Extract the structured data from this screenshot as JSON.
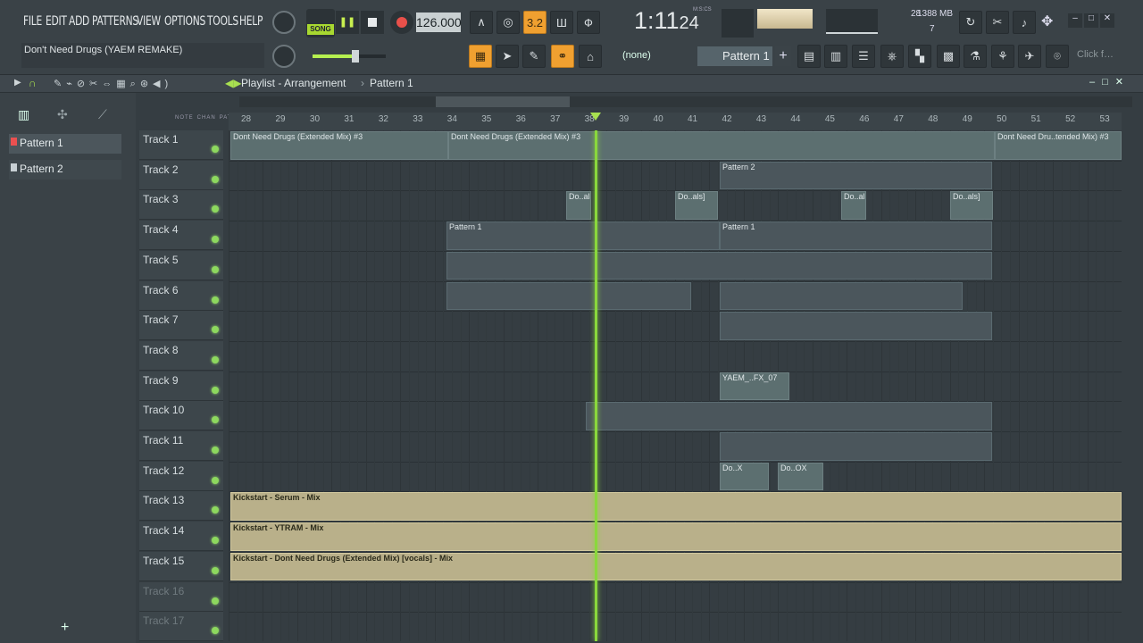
{
  "menu": [
    "FILE",
    "EDIT",
    "ADD",
    "PATTERNS",
    "VIEW",
    "OPTIONS",
    "TOOLS",
    "HELP"
  ],
  "transport": {
    "mode": "SONG",
    "tempo": "126.000",
    "time": "1:11",
    "time_sub": "24",
    "time_unit": "M:S:CS"
  },
  "hint": "Don't Need Drugs (YAEM REMAKE)",
  "cpu": {
    "ram": "1388 MB",
    "poly": "28",
    "num": "7"
  },
  "pattern_select": {
    "none": "(none)",
    "current": "Pattern 1"
  },
  "click_hint": "Click f…",
  "breadcrumb": {
    "title": "Playlist - Arrangement",
    "pattern": "Pattern 1"
  },
  "picker": [
    {
      "label": "Pattern 1",
      "selected": true
    },
    {
      "label": "Pattern 2",
      "selected": false
    }
  ],
  "ruler": [
    "28",
    "29",
    "30",
    "31",
    "32",
    "33",
    "34",
    "35",
    "36",
    "37",
    "38",
    "39",
    "40",
    "41",
    "42",
    "43",
    "44",
    "45",
    "46",
    "47",
    "48",
    "49",
    "50",
    "51",
    "52",
    "53"
  ],
  "ruler_labels": [
    "NOTE",
    "CHAN",
    "PAT"
  ],
  "tracks": [
    {
      "name": "Track 1",
      "dim": false
    },
    {
      "name": "Track 2",
      "dim": false
    },
    {
      "name": "Track 3",
      "dim": false
    },
    {
      "name": "Track 4",
      "dim": false
    },
    {
      "name": "Track 5",
      "dim": false
    },
    {
      "name": "Track 6",
      "dim": false
    },
    {
      "name": "Track 7",
      "dim": false
    },
    {
      "name": "Track 8",
      "dim": false
    },
    {
      "name": "Track 9",
      "dim": false
    },
    {
      "name": "Track 10",
      "dim": false
    },
    {
      "name": "Track 11",
      "dim": false
    },
    {
      "name": "Track 12",
      "dim": false
    },
    {
      "name": "Track 13",
      "dim": false
    },
    {
      "name": "Track 14",
      "dim": false
    },
    {
      "name": "Track 15",
      "dim": false
    },
    {
      "name": "Track 16",
      "dim": true
    },
    {
      "name": "Track 17",
      "dim": true
    }
  ],
  "clips": {
    "t1a": "Dont Need Drugs (Extended Mix) #3",
    "t1b": "Dont Need Drugs (Extended Mix) #3",
    "t1c": "Dont Need Dru..tended Mix) #3",
    "t2": "Pattern 2",
    "t3": "Do..als]",
    "t4": "Pattern 1",
    "t9": "YAEM_..FX_07",
    "t12a": "Do..X",
    "t12b": "Do..OX",
    "t13": "Kickstart - Serum - Mix",
    "t14": "Kickstart - YTRAM - Mix",
    "t15": "Kickstart - Dont Need Drugs (Extended Mix) [vocals] - Mix"
  },
  "colors": {
    "accent": "#f0a030",
    "led": "#8dd85e",
    "playhead": "#8ad83c"
  }
}
